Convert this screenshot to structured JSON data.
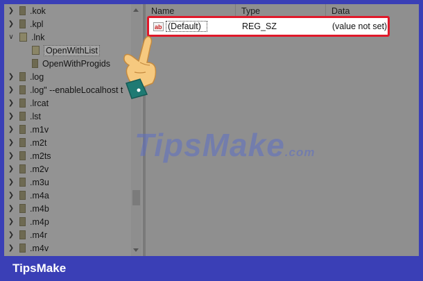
{
  "tree": {
    "items": [
      {
        "label": ".kok",
        "expanded": false,
        "level": 0
      },
      {
        "label": ".kpl",
        "expanded": false,
        "level": 0
      },
      {
        "label": ".lnk",
        "expanded": true,
        "level": 0
      },
      {
        "label": "OpenWithList",
        "selected": true,
        "level": 1
      },
      {
        "label": "OpenWithProgids",
        "level": 1
      },
      {
        "label": ".log",
        "expanded": false,
        "level": 0
      },
      {
        "label": ".log\" --enableLocalhost t",
        "expanded": false,
        "level": 0
      },
      {
        "label": ".lrcat",
        "expanded": false,
        "level": 0
      },
      {
        "label": ".lst",
        "expanded": false,
        "level": 0
      },
      {
        "label": ".m1v",
        "expanded": false,
        "level": 0
      },
      {
        "label": ".m2t",
        "expanded": false,
        "level": 0
      },
      {
        "label": ".m2ts",
        "expanded": false,
        "level": 0
      },
      {
        "label": ".m2v",
        "expanded": false,
        "level": 0
      },
      {
        "label": ".m3u",
        "expanded": false,
        "level": 0
      },
      {
        "label": ".m4a",
        "expanded": false,
        "level": 0
      },
      {
        "label": ".m4b",
        "expanded": false,
        "level": 0
      },
      {
        "label": ".m4p",
        "expanded": false,
        "level": 0
      },
      {
        "label": ".m4r",
        "expanded": false,
        "level": 0
      },
      {
        "label": ".m4v",
        "expanded": false,
        "level": 0
      }
    ]
  },
  "list": {
    "columns": [
      "Name",
      "Type",
      "Data"
    ],
    "rows": [
      {
        "name": "(Default)",
        "type": "REG_SZ",
        "data": "(value not set)",
        "icon": "string-value-icon"
      }
    ]
  },
  "watermark": {
    "main": "TipsMake",
    "suffix": ".com"
  },
  "brand": "TipsMake",
  "colors": {
    "highlight": "#e0192a",
    "brand_bar": "#3a3fb6"
  }
}
